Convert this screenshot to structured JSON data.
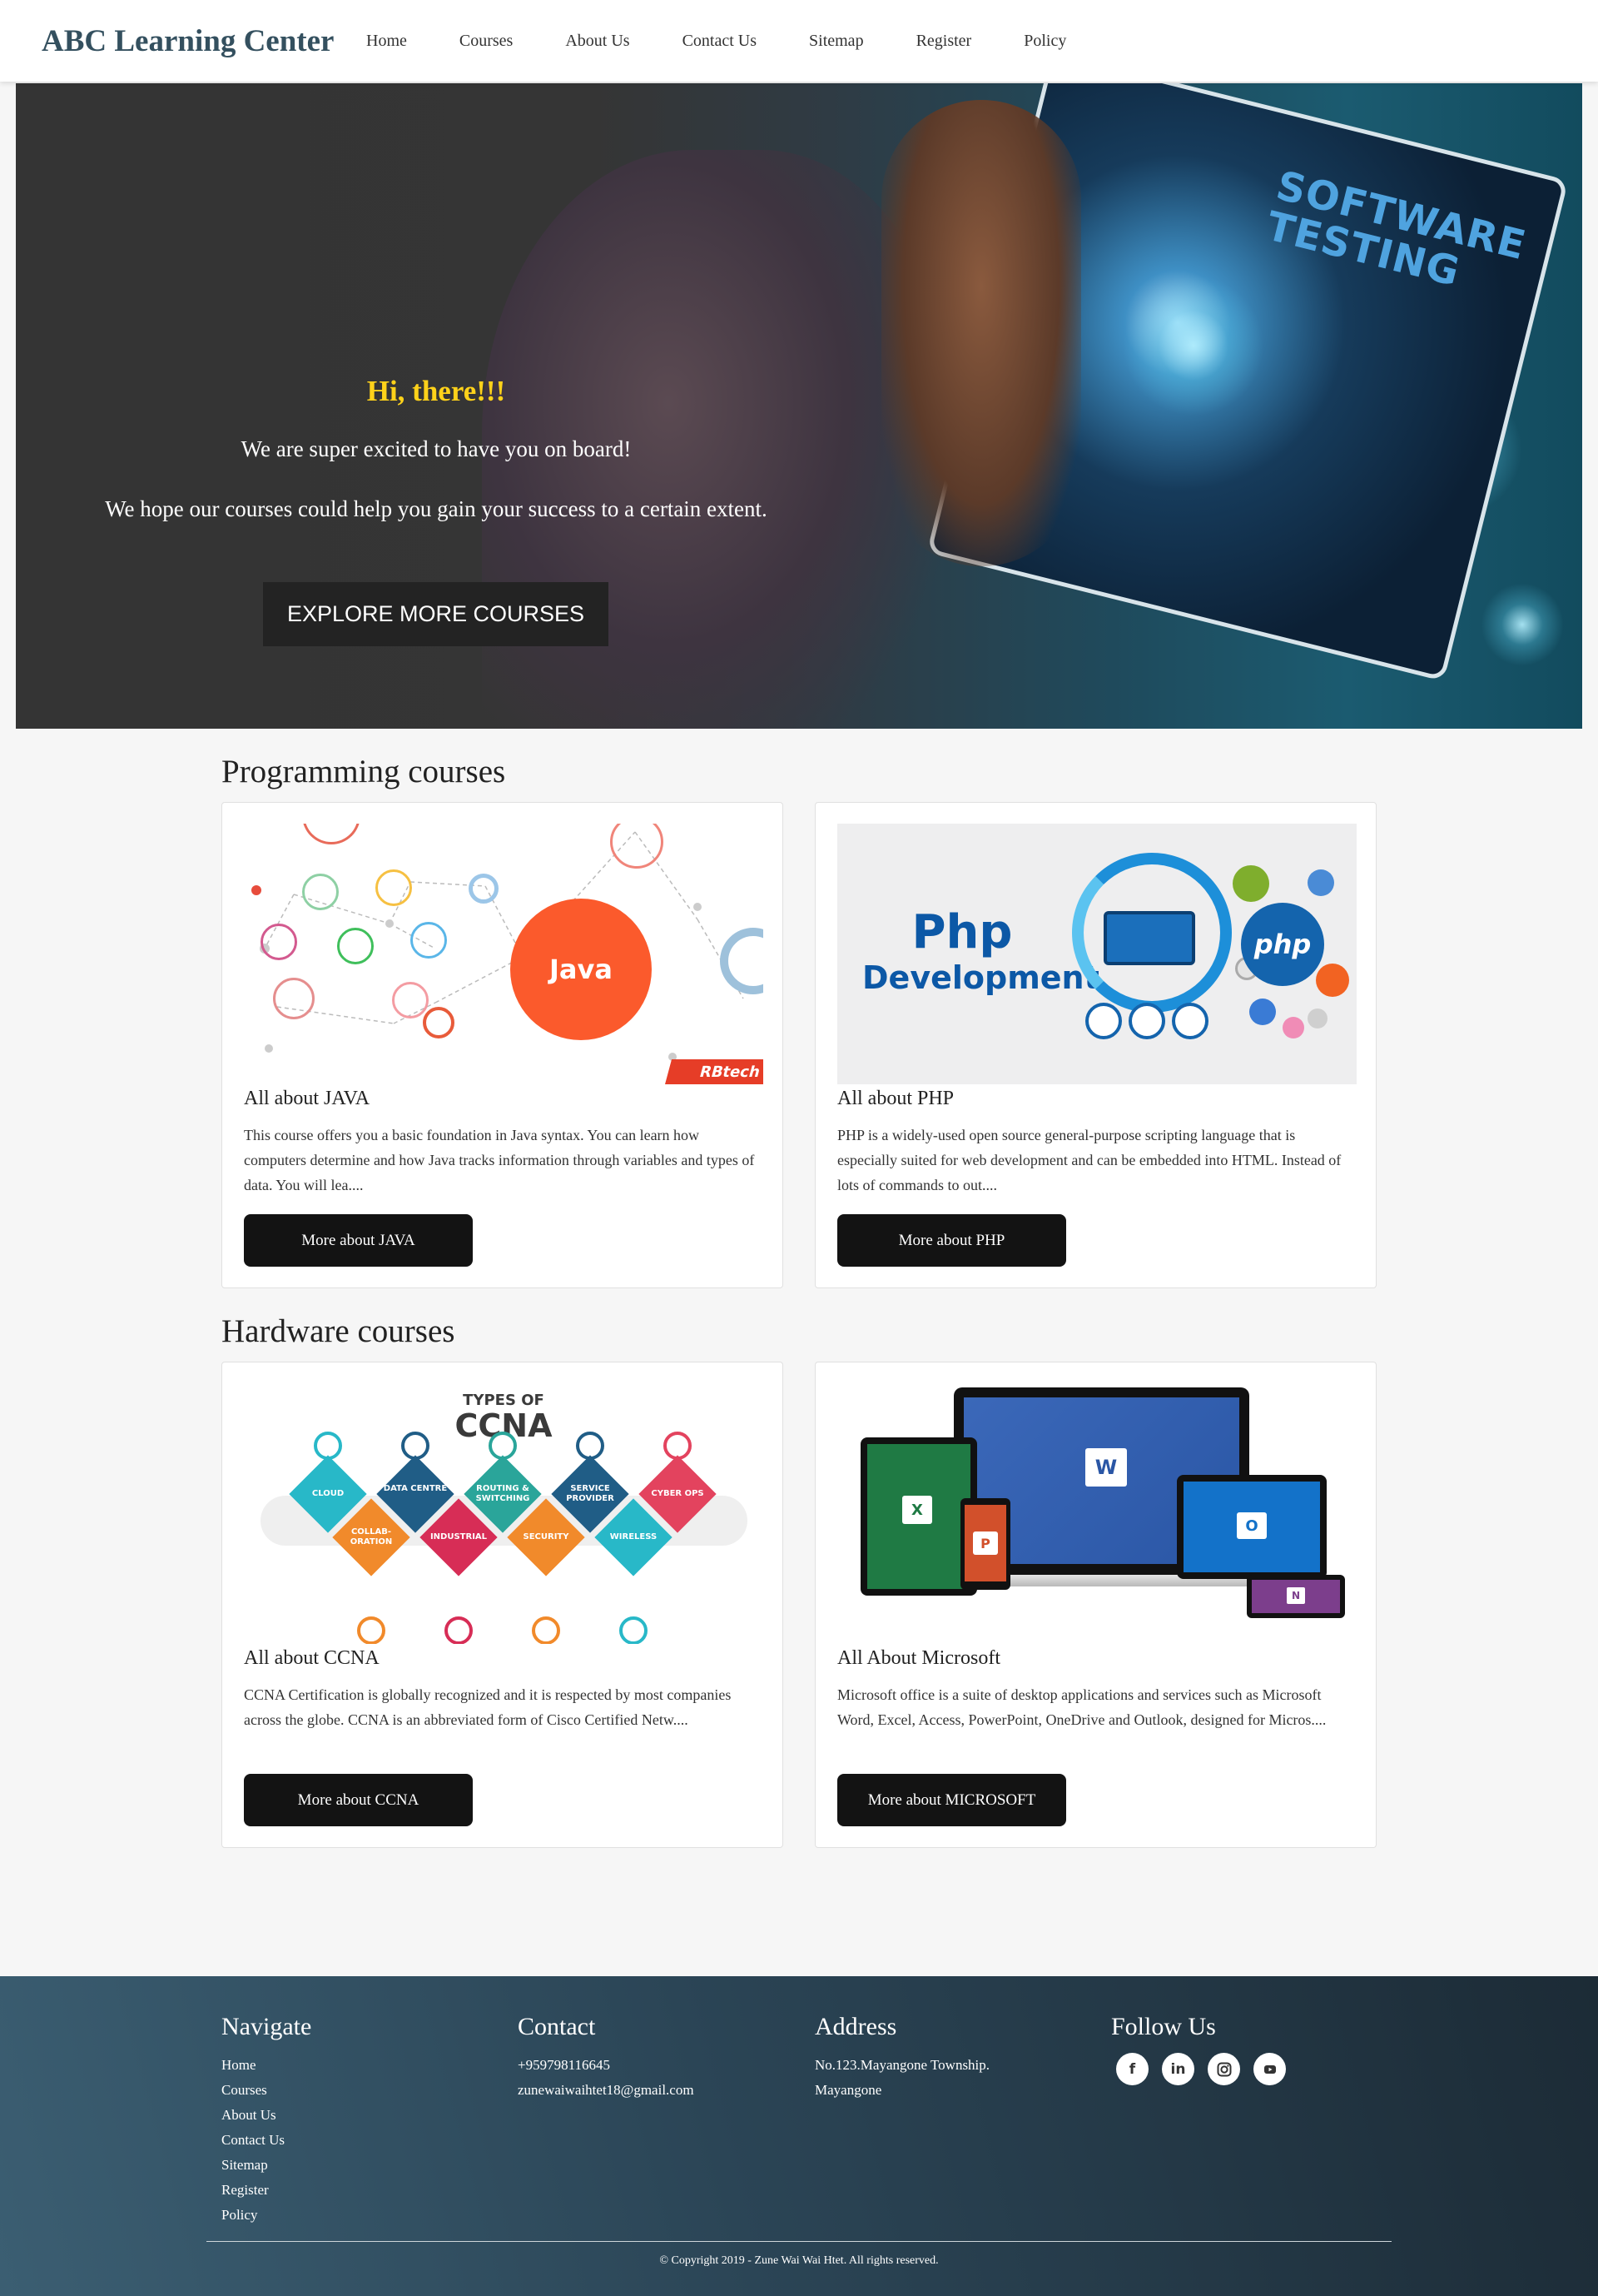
{
  "nav": {
    "brand": "ABC Learning Center",
    "links": [
      "Home",
      "Courses",
      "About Us",
      "Contact Us",
      "Sitemap",
      "Register",
      "Policy"
    ]
  },
  "hero": {
    "greeting": "Hi, there!!!",
    "line1": "We are super excited to have you on board!",
    "line2": "We hope our courses could help you gain your success to a certain extent.",
    "button": "EXPLORE MORE COURSES",
    "image_text": "SOFTWARE TESTING"
  },
  "sections": [
    {
      "title": "Programming courses",
      "cards": [
        {
          "title": "All about JAVA",
          "text": "This course offers you a basic foundation in Java syntax. You can learn how computers determine and how Java tracks information through variables and types of data. You will lea....",
          "button": "More about JAVA",
          "image_label": "Java",
          "image_tag": "RBtech"
        },
        {
          "title": "All about PHP",
          "text": "PHP is a widely-used open source general-purpose scripting language that is especially suited for web development and can be embedded into HTML. Instead of lots of commands to out....",
          "button": "More about PHP",
          "image_label_1": "Php",
          "image_label_2": "Development",
          "image_badge": "php"
        }
      ]
    },
    {
      "title": "Hardware courses",
      "cards": [
        {
          "title": "All about CCNA",
          "text": "CCNA Certification is globally recognized and it is respected by most companies across the globe. CCNA is an abbreviated form of Cisco Certified Netw....",
          "button": "More about CCNA",
          "image_title_1": "TYPES OF",
          "image_title_2": "CCNA",
          "image_types": [
            "CLOUD",
            "DATA CENTRE",
            "ROUTING & SWITCHING",
            "SERVICE PROVIDER",
            "CYBER OPS",
            "COLLAB- ORATION",
            "INDUSTRIAL",
            "SECURITY",
            "WIRELESS"
          ]
        },
        {
          "title": "All About Microsoft",
          "text": "Microsoft office is a suite of desktop applications and services such as Microsoft Word, Excel, Access, PowerPoint, OneDrive and Outlook, designed for Micros....",
          "button": "More about MICROSOFT"
        }
      ]
    }
  ],
  "footer": {
    "navigate": {
      "heading": "Navigate",
      "links": [
        "Home",
        "Courses",
        "About Us",
        "Contact Us",
        "Sitemap",
        "Register",
        "Policy"
      ]
    },
    "contact": {
      "heading": "Contact",
      "phone": "+959798116645",
      "email": "zunewaiwaihtet18@gmail.com"
    },
    "address": {
      "heading": "Address",
      "line1": "No.123.Mayangone Township.",
      "line2": "Mayangone"
    },
    "follow": {
      "heading": "Follow Us",
      "icons": [
        "facebook-icon",
        "linkedin-icon",
        "instagram-icon",
        "youtube-icon"
      ]
    },
    "copyright": "© Copyright 2019 - Zune Wai Wai Htet. All rights reserved."
  },
  "colors": {
    "brand": "#34505f",
    "hero_greeting": "#ffd21a",
    "button_dark": "#131313",
    "footer_start": "#3b5e72",
    "footer_end": "#1c2b36"
  }
}
